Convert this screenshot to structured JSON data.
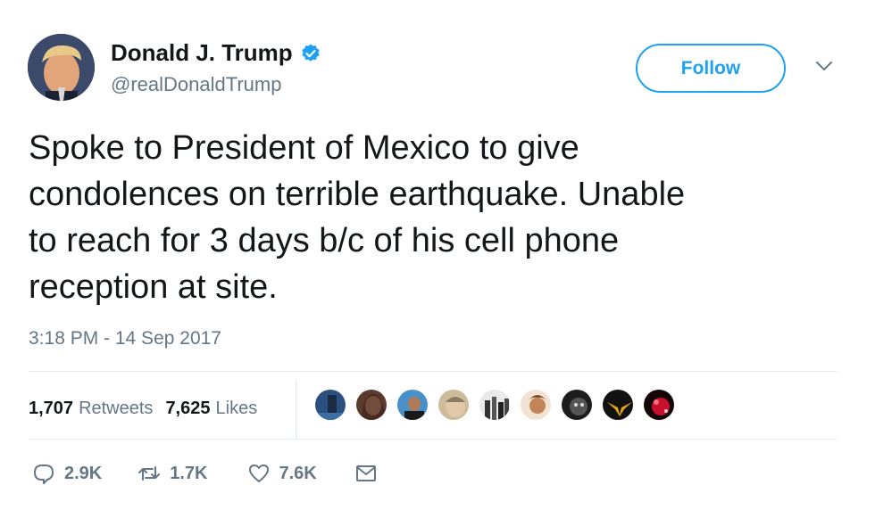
{
  "user": {
    "name": "Donald J. Trump",
    "handle": "@realDonaldTrump"
  },
  "follow_label": "Follow",
  "tweet": {
    "text": "Spoke to President of Mexico to give\ncondolences on terrible earthquake. Unable\nto reach for 3 days b/c of his cell phone\nreception at site.",
    "timestamp": "3:18 PM - 14 Sep 2017"
  },
  "stats": {
    "retweets_count": "1,707",
    "retweets_label": "Retweets",
    "likes_count": "7,625",
    "likes_label": "Likes"
  },
  "actions": {
    "reply_count": "2.9K",
    "retweet_count": "1.7K",
    "like_count": "7.6K"
  },
  "icons": [
    "verified-badge-icon",
    "chevron-down-icon",
    "reply-icon",
    "retweet-icon",
    "heart-icon",
    "direct-message-icon"
  ],
  "colors": {
    "accent": "#1da1f2",
    "muted_text": "#657786",
    "text": "#14171a",
    "divider": "#e1e8ed"
  }
}
